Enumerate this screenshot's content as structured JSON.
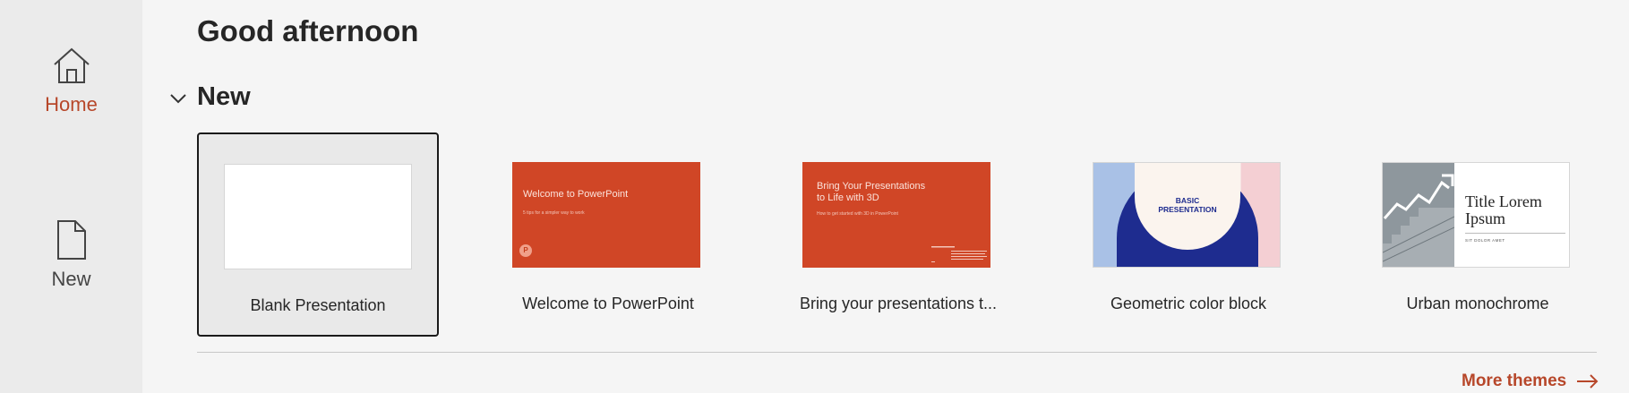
{
  "sidebar": {
    "items": [
      {
        "label": "Home",
        "icon": "home-icon",
        "active": true
      },
      {
        "label": "New",
        "icon": "new-document-icon",
        "active": false
      }
    ]
  },
  "main": {
    "greeting": "Good afternoon",
    "section": {
      "title": "New",
      "expanded": true
    },
    "templates": [
      {
        "label": "Blank Presentation",
        "selected": true
      },
      {
        "label": "Welcome to PowerPoint",
        "thumb_title": "Welcome to PowerPoint",
        "thumb_subtitle": "5 tips for a simpler way to work"
      },
      {
        "label": "Bring your presentations t...",
        "thumb_title_line1": "Bring Your Presentations",
        "thumb_title_line2": "to Life with 3D",
        "thumb_subtitle": "How to get started with 3D in PowerPoint"
      },
      {
        "label": "Geometric color block",
        "thumb_title_line1": "BASIC",
        "thumb_title_line2": "PRESENTATION"
      },
      {
        "label": "Urban monochrome",
        "thumb_title_line1": "Title Lorem",
        "thumb_title_line2": "Ipsum",
        "thumb_subtitle": "SIT DOLOR AMET"
      }
    ],
    "more_themes_label": "More themes"
  },
  "colors": {
    "accent": "#b7472a",
    "sidebar_bg": "#ebebeb",
    "page_bg": "#f5f5f5",
    "thumb_orange": "#d04626",
    "geo_blue": "#1e2c8f"
  }
}
